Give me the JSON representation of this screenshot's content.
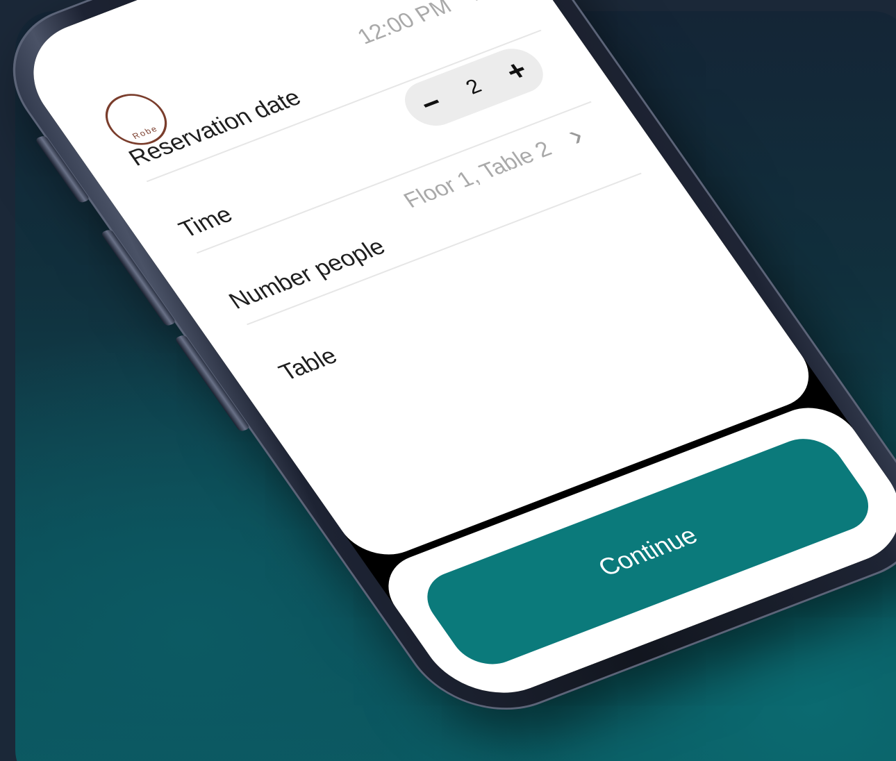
{
  "brand": {
    "logo_text": "Robe",
    "accent_color": "#0b7a7b"
  },
  "form": {
    "rows": [
      {
        "label": "Reservation date",
        "value": "12:00 PM",
        "trailing": "chevron"
      },
      {
        "label": "Time",
        "trailing": "stepper"
      },
      {
        "label": "Number people",
        "value": "Floor 1, Table 2",
        "trailing": "chevron"
      },
      {
        "label": "Table"
      }
    ],
    "stepper": {
      "decrement": "−",
      "value": "2",
      "increment": "+"
    }
  },
  "footer": {
    "continue_label": "Continue"
  }
}
